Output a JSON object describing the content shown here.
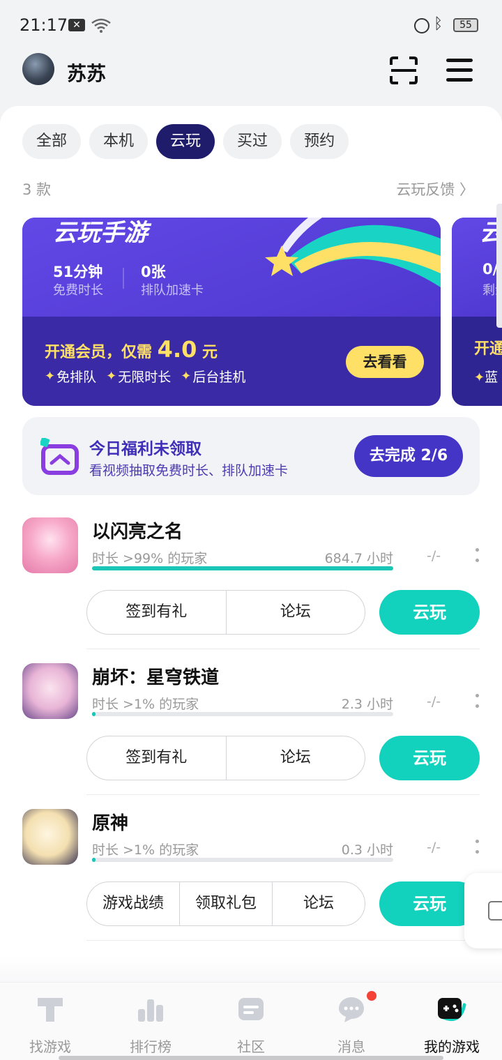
{
  "status_bar": {
    "time": "21:17",
    "battery": "55"
  },
  "header": {
    "username": "苏苏"
  },
  "filters": [
    "全部",
    "本机",
    "云玩",
    "买过",
    "预约"
  ],
  "active_filter_index": 2,
  "list_meta": {
    "count": "3 款",
    "feedback": "云玩反馈 〉"
  },
  "banner": {
    "title": "云玩手游",
    "stat1_value": "51分钟",
    "stat1_label": "免费时长",
    "stat2_value": "0张",
    "stat2_label": "排队加速卡",
    "promo_prefix": "开通会员，仅需 ",
    "promo_price": "4.0",
    "promo_suffix": " 元",
    "perks": [
      "免排队",
      "无限时长",
      "后台挂机"
    ],
    "cta": "去看看",
    "colors": {
      "primary": "#4b33c7",
      "accent": "#ffe066"
    }
  },
  "banner_peek": {
    "title": "云",
    "stat": "0/",
    "label": "剩余",
    "promo": "开通",
    "perk": "蓝"
  },
  "daily_task": {
    "title": "今日福利未领取",
    "subtitle": "看视频抽取免费时长、排队加速卡",
    "button": "去完成 2/6"
  },
  "games": [
    {
      "name": "以闪亮之名",
      "percentile": "时长 >99% 的玩家",
      "hours": "684.7 小时",
      "rating": "-/-",
      "progress": 1.0,
      "actions": [
        "签到有礼",
        "论坛"
      ],
      "play": "云玩",
      "icon": "shining-nikki-icon"
    },
    {
      "name": "崩坏：星穹铁道",
      "percentile": "时长 >1% 的玩家",
      "hours": "2.3 小时",
      "rating": "-/-",
      "progress": 0.01,
      "actions": [
        "签到有礼",
        "论坛"
      ],
      "play": "云玩",
      "icon": "star-rail-icon"
    },
    {
      "name": "原神",
      "percentile": "时长 >1% 的玩家",
      "hours": "0.3 小时",
      "rating": "-/-",
      "progress": 0.01,
      "actions": [
        "游戏战绩",
        "领取礼包",
        "论坛"
      ],
      "play": "云玩",
      "icon": "genshin-icon"
    }
  ],
  "bottom_nav": [
    {
      "label": "找游戏",
      "icon": "find-game-icon",
      "active": false
    },
    {
      "label": "排行榜",
      "icon": "ranking-icon",
      "active": false
    },
    {
      "label": "社区",
      "icon": "community-icon",
      "active": false
    },
    {
      "label": "消息",
      "icon": "message-icon",
      "active": false,
      "badge": true
    },
    {
      "label": "我的游戏",
      "icon": "my-games-icon",
      "active": true
    }
  ]
}
